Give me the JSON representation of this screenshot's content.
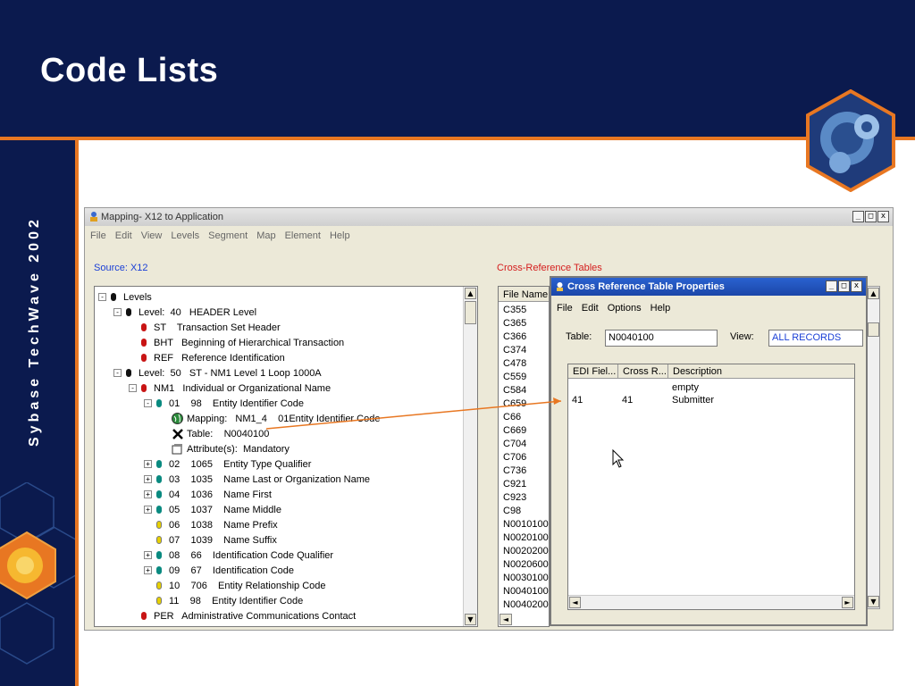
{
  "slide": {
    "title": "Code Lists",
    "side_text": "Sybase TechWave 2002"
  },
  "window": {
    "title": "Mapping- X12 to Application",
    "min": "_",
    "max": "□",
    "close": "x",
    "menu": [
      "File",
      "Edit",
      "View",
      "Levels",
      "Segment",
      "Map",
      "Element",
      "Help"
    ],
    "source_label": "Source: X12",
    "xref_label": "Cross-Reference Tables"
  },
  "tree": [
    {
      "indent": 0,
      "exp": "-",
      "dot": "b",
      "text": "Levels"
    },
    {
      "indent": 1,
      "exp": "-",
      "dot": "b",
      "text": "Level:  40   HEADER Level"
    },
    {
      "indent": 2,
      "exp": "",
      "dot": "r",
      "text": "ST    Transaction Set Header"
    },
    {
      "indent": 2,
      "exp": "",
      "dot": "r",
      "text": "BHT   Beginning of Hierarchical Transaction"
    },
    {
      "indent": 2,
      "exp": "",
      "dot": "r",
      "text": "REF   Reference Identification"
    },
    {
      "indent": 1,
      "exp": "-",
      "dot": "b",
      "text": "Level:  50   ST - NM1 Level 1 Loop 1000A"
    },
    {
      "indent": 2,
      "exp": "-",
      "dot": "r",
      "text": "NM1   Individual or Organizational Name"
    },
    {
      "indent": 3,
      "exp": "-",
      "dot": "t",
      "text": "01    98    Entity Identifier Code"
    },
    {
      "indent": 4,
      "exp": "",
      "dot": "globe",
      "text": "Mapping:   NM1_4    01Entity Identifier Code"
    },
    {
      "indent": 4,
      "exp": "",
      "dot": "x",
      "text": "Table:    N0040100"
    },
    {
      "indent": 4,
      "exp": "",
      "dot": "attr",
      "text": "Attribute(s):  Mandatory"
    },
    {
      "indent": 3,
      "exp": "+",
      "dot": "t",
      "text": "02    1065    Entity Type Qualifier"
    },
    {
      "indent": 3,
      "exp": "+",
      "dot": "t",
      "text": "03    1035    Name Last or Organization Name"
    },
    {
      "indent": 3,
      "exp": "+",
      "dot": "t",
      "text": "04    1036    Name First"
    },
    {
      "indent": 3,
      "exp": "+",
      "dot": "t",
      "text": "05    1037    Name Middle"
    },
    {
      "indent": 3,
      "exp": "",
      "dot": "y",
      "text": "06    1038    Name Prefix"
    },
    {
      "indent": 3,
      "exp": "",
      "dot": "y",
      "text": "07    1039    Name Suffix"
    },
    {
      "indent": 3,
      "exp": "+",
      "dot": "t",
      "text": "08    66    Identification Code Qualifier"
    },
    {
      "indent": 3,
      "exp": "+",
      "dot": "t",
      "text": "09    67    Identification Code"
    },
    {
      "indent": 3,
      "exp": "",
      "dot": "y",
      "text": "10    706    Entity Relationship Code"
    },
    {
      "indent": 3,
      "exp": "",
      "dot": "y",
      "text": "11    98    Entity Identifier Code"
    },
    {
      "indent": 2,
      "exp": "",
      "dot": "r",
      "text": "PER   Administrative Communications Contact"
    }
  ],
  "files": {
    "header": "File Name",
    "items": [
      "C355",
      "C365",
      "C366",
      "C374",
      "C478",
      "C559",
      "C584",
      "C659",
      "C66",
      "C669",
      "C704",
      "C706",
      "C736",
      "C921",
      "C923",
      "C98",
      "N0010100",
      "N0020100",
      "N0020200",
      "N0020600",
      "N0030100",
      "N0040100",
      "N0040200"
    ]
  },
  "dialog": {
    "title": "Cross Reference Table Properties",
    "menu": [
      "File",
      "Edit",
      "Options",
      "Help"
    ],
    "table_label": "Table:",
    "table_value": "N0040100",
    "view_label": "View:",
    "view_value": "ALL RECORDS",
    "columns": [
      "EDI Fiel...",
      "Cross R...",
      "Description"
    ],
    "rows": [
      [
        "",
        "",
        "empty"
      ],
      [
        "41",
        "41",
        "Submitter"
      ]
    ]
  },
  "scroll": {
    "up": "▲",
    "down": "▼",
    "left": "◄",
    "right": "►"
  }
}
